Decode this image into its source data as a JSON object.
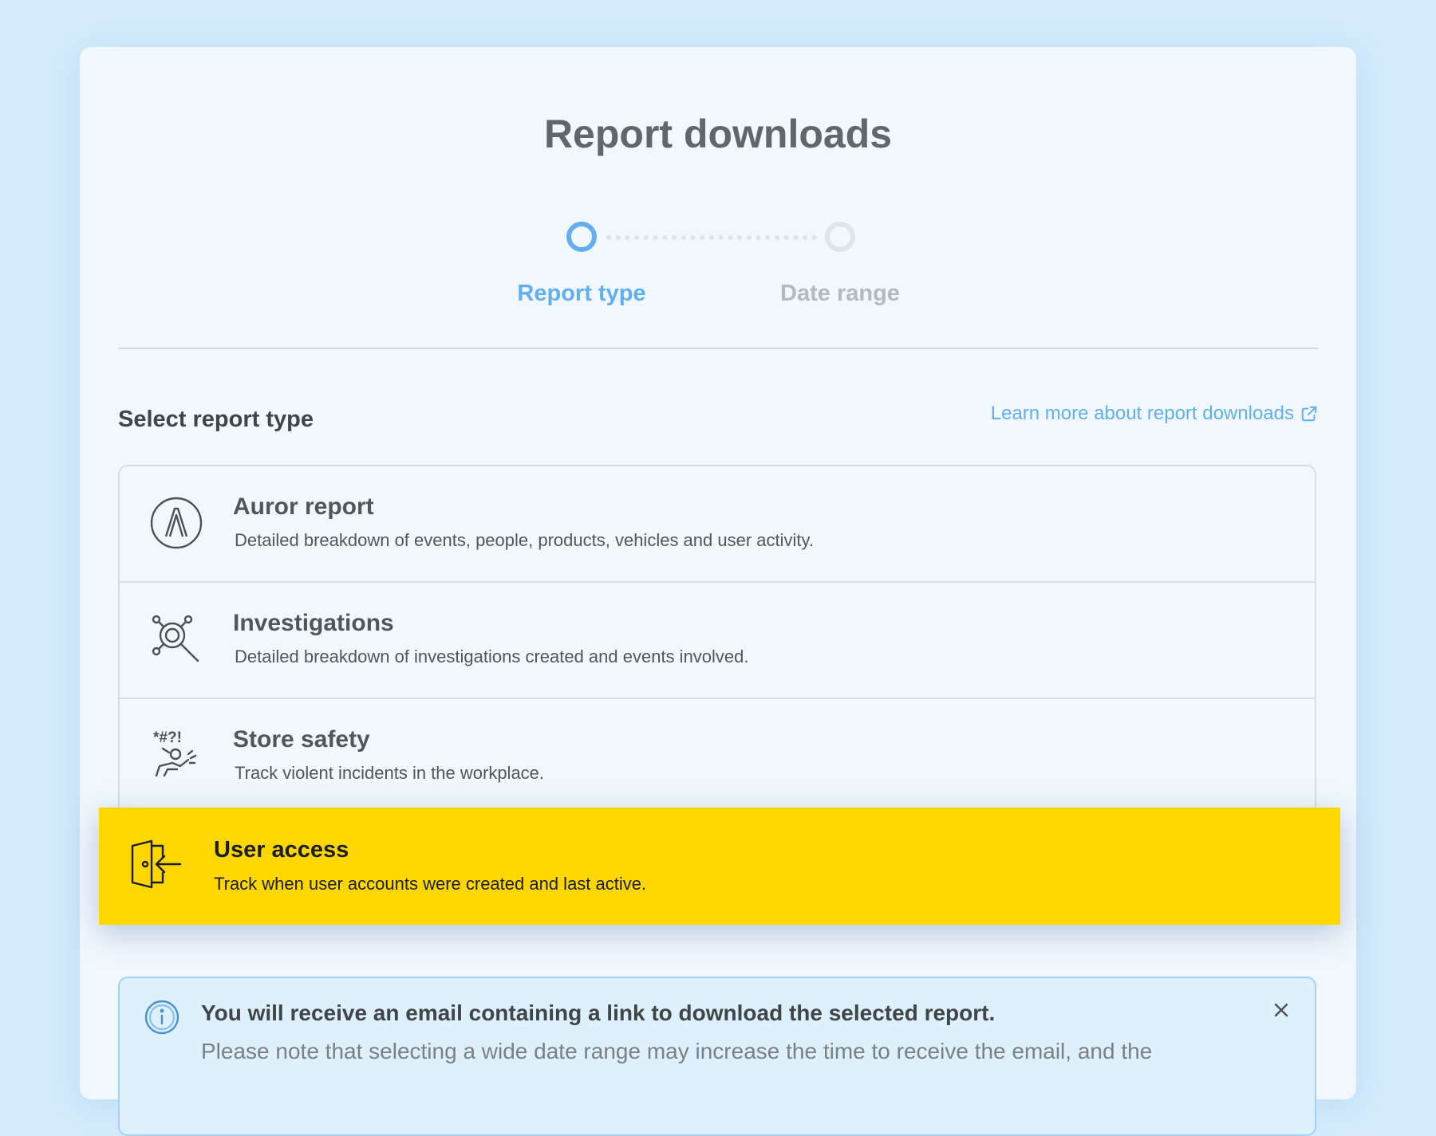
{
  "page": {
    "title": "Report downloads"
  },
  "stepper": {
    "steps": [
      {
        "label": "Report type",
        "state": "active"
      },
      {
        "label": "Date range",
        "state": "inactive"
      }
    ],
    "colors": {
      "active": "#62aeee",
      "inactive": "#b4b9bc"
    }
  },
  "section": {
    "title": "Select report type",
    "learn_more": "Learn more about report downloads"
  },
  "report_types": [
    {
      "name": "Auror report",
      "description": "Detailed breakdown of events, people, products, vehicles and user activity.",
      "icon": "auror-logo-icon"
    },
    {
      "name": "Investigations",
      "description": "Detailed breakdown of investigations created and events involved.",
      "icon": "investigation-icon"
    },
    {
      "name": "Store safety",
      "description": "Track violent incidents in the workplace.",
      "icon": "store-safety-icon",
      "icon_text": "*#?!"
    },
    {
      "name": "User access",
      "description": "Track when user accounts were created and last active.",
      "icon": "door-enter-icon",
      "selected": true
    }
  ],
  "highlight_color": "#fed600",
  "notice": {
    "headline": "You will receive an email containing a link to download the selected report.",
    "body": "Please note that selecting a wide date range may increase the time to receive the email, and the",
    "icon": "info-icon"
  }
}
